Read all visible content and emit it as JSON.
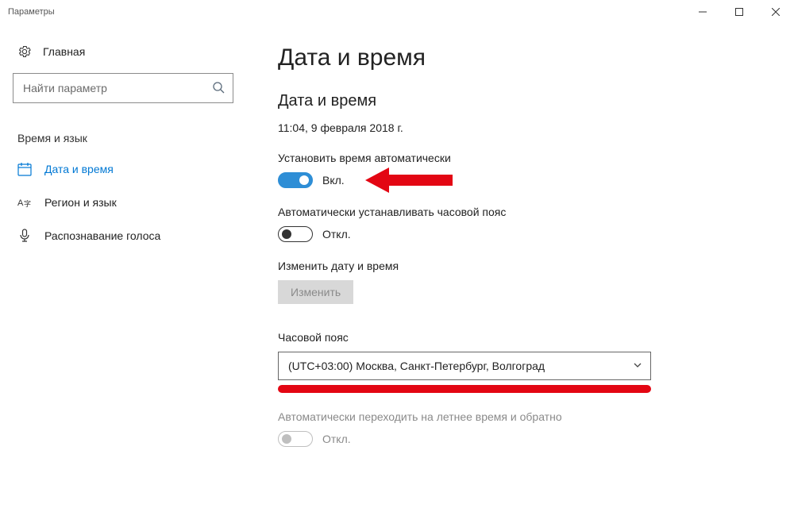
{
  "window": {
    "title": "Параметры"
  },
  "sidebar": {
    "home_label": "Главная",
    "search_placeholder": "Найти параметр",
    "section_label": "Время и язык",
    "items": [
      {
        "label": "Дата и время",
        "active": true,
        "icon": "calendar"
      },
      {
        "label": "Регион и язык",
        "active": false,
        "icon": "globe"
      },
      {
        "label": "Распознавание голоса",
        "active": false,
        "icon": "mic"
      }
    ]
  },
  "main": {
    "title": "Дата и время",
    "group_heading": "Дата и время",
    "current_datetime": "11:04, 9 февраля 2018 г.",
    "auto_time": {
      "label": "Установить время автоматически",
      "state_label": "Вкл.",
      "on": true
    },
    "auto_tz": {
      "label": "Автоматически устанавливать часовой пояс",
      "state_label": "Откл.",
      "on": false
    },
    "change": {
      "label": "Изменить дату и время",
      "button_label": "Изменить"
    },
    "timezone": {
      "label": "Часовой пояс",
      "selected": "(UTC+03:00) Москва, Санкт-Петербург, Волгоград"
    },
    "dst": {
      "label": "Автоматически переходить на летнее время и обратно",
      "state_label": "Откл.",
      "on": false,
      "disabled": true
    }
  },
  "annotations": {
    "arrow_color": "#e30613",
    "underline_color": "#e30613"
  }
}
